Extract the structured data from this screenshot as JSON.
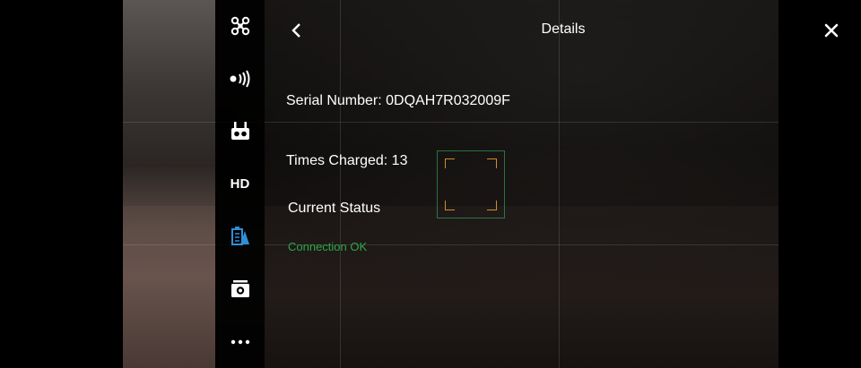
{
  "header": {
    "title": "Details"
  },
  "details": {
    "serial_number": "Serial Number: 0DQAH7R032009F",
    "times_charged": "Times Charged: 13",
    "current_status_label": "Current Status",
    "status_value": "Connection OK"
  },
  "sidebar": {
    "items": [
      {
        "name": "aircraft-icon"
      },
      {
        "name": "signal-icon"
      },
      {
        "name": "remote-controller-icon"
      },
      {
        "name": "hd-label",
        "label": "HD"
      },
      {
        "name": "battery-icon"
      },
      {
        "name": "camera-icon"
      },
      {
        "name": "more-icon",
        "label": "•••"
      }
    ]
  },
  "colors": {
    "status_ok": "#2fa84a",
    "active_icon": "#2e8fd8"
  }
}
